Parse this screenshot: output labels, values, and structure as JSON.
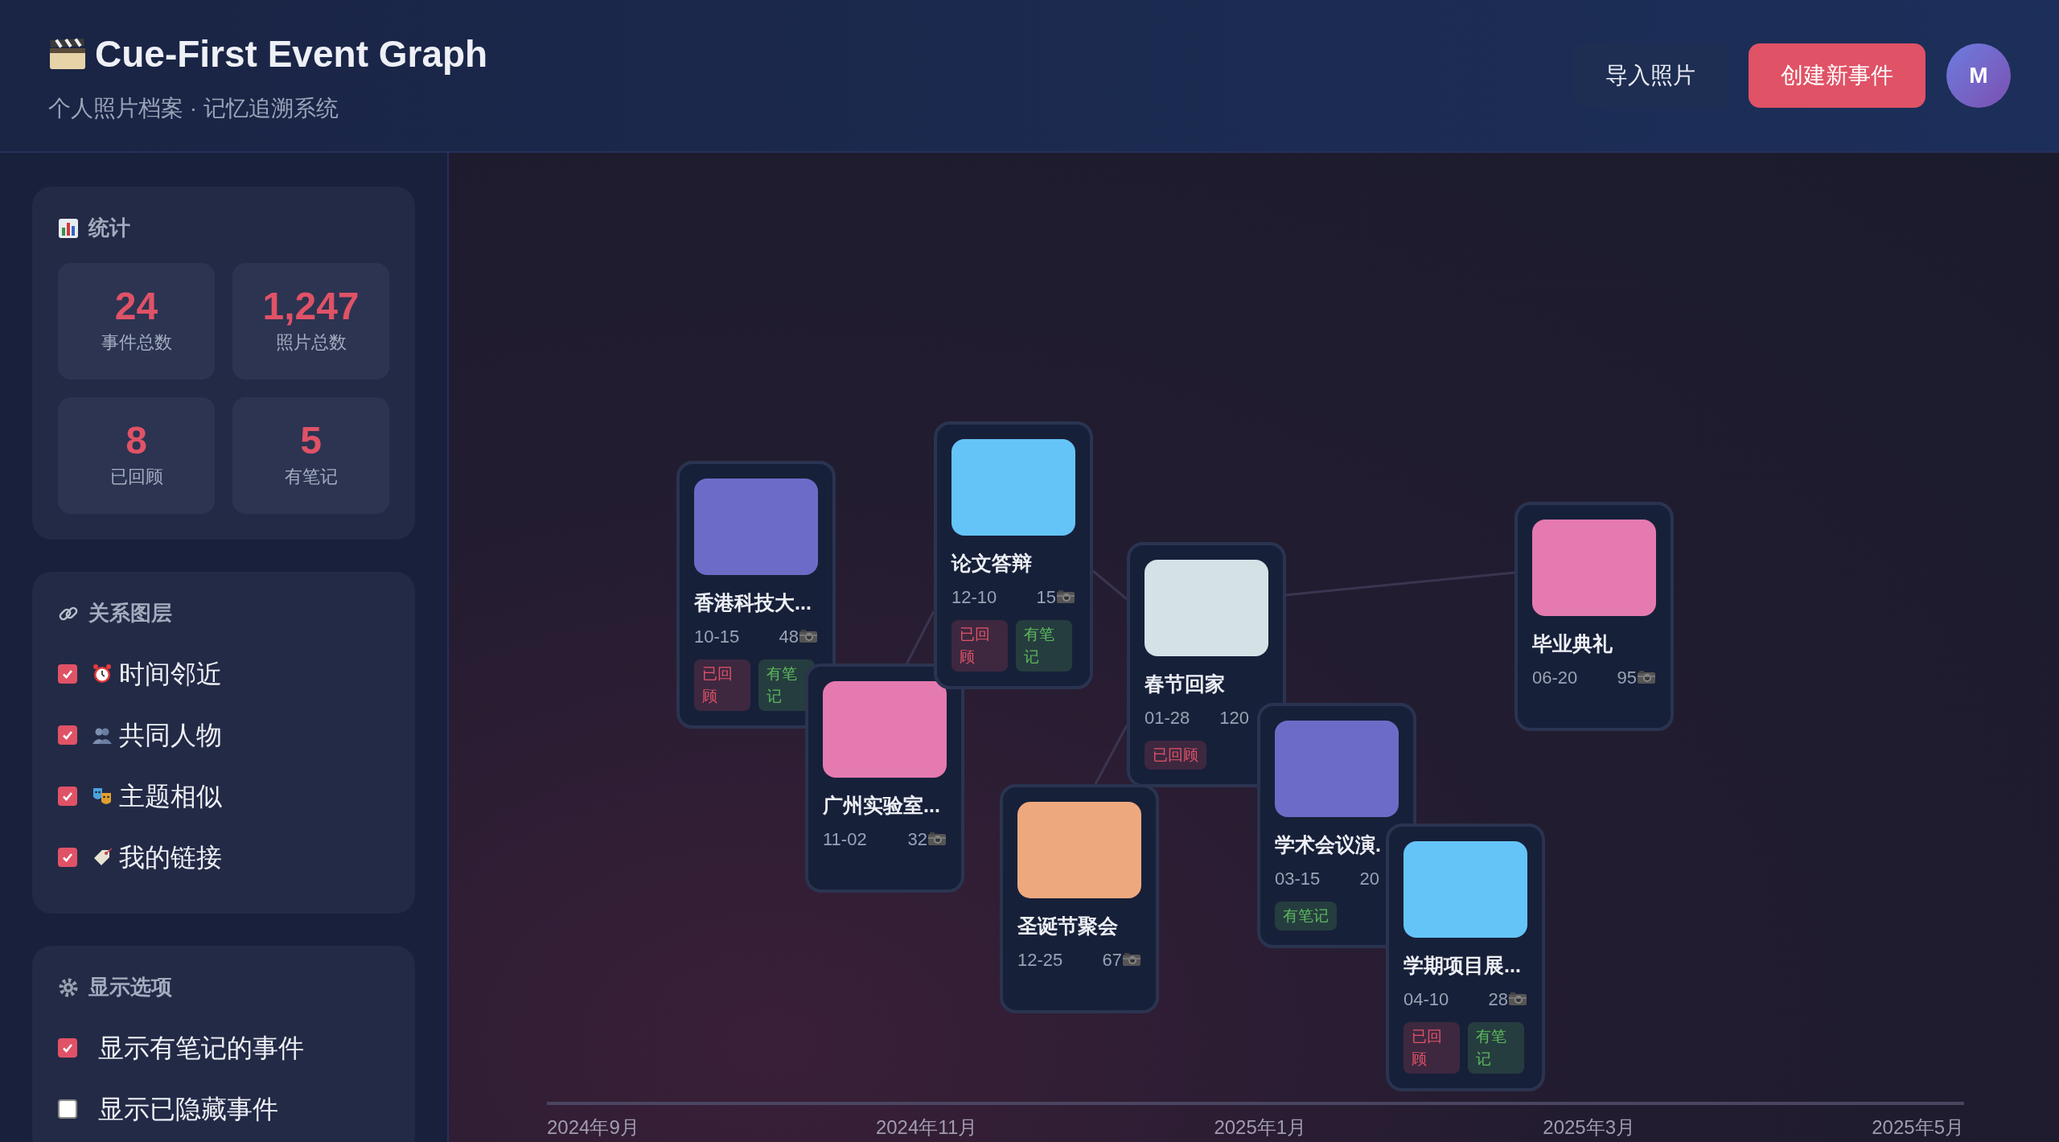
{
  "header": {
    "title": "Cue-First Event Graph",
    "subtitle": "个人照片档案 · 记忆追溯系统",
    "buttons": [
      {
        "label": "导入照片",
        "kind": "secondary"
      },
      {
        "label": "创建新事件",
        "kind": "primary"
      }
    ],
    "avatar": "M"
  },
  "sidebar": {
    "stats": {
      "title": "统计",
      "items": [
        {
          "value": "24",
          "label": "事件总数"
        },
        {
          "value": "1,247",
          "label": "照片总数"
        },
        {
          "value": "8",
          "label": "已回顾"
        },
        {
          "value": "5",
          "label": "有笔记"
        }
      ]
    },
    "layers": {
      "title": "关系图层",
      "items": [
        {
          "label": "时间邻近",
          "kind": "time",
          "checked": true
        },
        {
          "label": "共同人物",
          "kind": "people",
          "checked": true
        },
        {
          "label": "主题相似",
          "kind": "theme",
          "checked": true
        },
        {
          "label": "我的链接",
          "kind": "manual",
          "checked": true
        }
      ]
    },
    "display": {
      "title": "显示选项",
      "items": [
        {
          "label": "显示有笔记的事件",
          "checked": true
        },
        {
          "label": "显示已隐藏事件",
          "checked": false
        }
      ]
    }
  },
  "graph": {
    "events": [
      {
        "title": "香港科技大...",
        "date": "10-15",
        "count": "48",
        "camera": true,
        "color": "#6c6cc8",
        "tags": [
          {
            "label": "已回顾",
            "kind": "reviewed"
          },
          {
            "label": "有笔记",
            "kind": "notes"
          }
        ]
      },
      {
        "title": "广州实验室...",
        "date": "11-02",
        "count": "32",
        "camera": true,
        "color": "#e47ab0"
      },
      {
        "title": "论文答辩",
        "date": "12-10",
        "count": "15",
        "camera": true,
        "color": "#64c4f8",
        "tags": [
          {
            "label": "已回顾",
            "kind": "reviewed"
          },
          {
            "label": "有笔记",
            "kind": "notes"
          }
        ]
      },
      {
        "title": "圣诞节聚会",
        "date": "12-25",
        "count": "67",
        "camera": true,
        "color": "#eea87e"
      },
      {
        "title": "春节回家",
        "date": "01-28",
        "count": "120",
        "camera": false,
        "color": "#d4e2e6",
        "tags": [
          {
            "label": "已回顾",
            "kind": "reviewed"
          }
        ]
      },
      {
        "title": "学术会议演.",
        "date": "03-15",
        "count": "20",
        "camera": false,
        "color": "#6c6cc8",
        "tags": [
          {
            "label": "有笔记",
            "kind": "notes"
          }
        ]
      },
      {
        "title": "学期项目展...",
        "date": "04-10",
        "count": "28",
        "camera": true,
        "color": "#64c4f8",
        "tags": [
          {
            "label": "已回顾",
            "kind": "reviewed"
          },
          {
            "label": "有笔记",
            "kind": "notes"
          }
        ]
      },
      {
        "title": "毕业典礼",
        "date": "06-20",
        "count": "95",
        "camera": true,
        "color": "#e47ab0"
      }
    ],
    "axis": [
      "2024年9月",
      "2024年11月",
      "2025年1月",
      "2025年3月",
      "2025年5月"
    ]
  }
}
